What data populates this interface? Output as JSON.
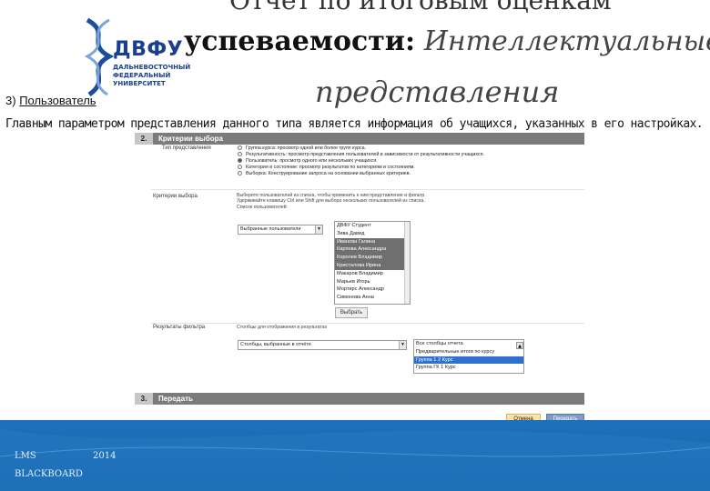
{
  "logo": {
    "name": "ДВФУ",
    "lines": [
      "ДАЛЬНЕВОСТОЧНЫЙ",
      "ФЕДЕРАЛЬНЫЙ",
      "УНИВЕРСИТЕТ"
    ]
  },
  "title": {
    "line1_partial": "Отчет по итоговым оценкам",
    "line2_bold": "успеваемости:",
    "line2_italic": "Интеллектуальные",
    "line3": "представления"
  },
  "section": {
    "number": "3)",
    "label": "Пользователь"
  },
  "description": "Главным параметром представления данного типа является информация об учащихся, указанных в его настройках.",
  "panel": {
    "step2": {
      "number": "2.",
      "title": "Критерии выбора"
    },
    "row_type": {
      "label": "Тип представления",
      "options": [
        {
          "text": "Группа курса: просмотр одной или более групп курса.",
          "selected": false
        },
        {
          "text": "Результативность: просмотр представления пользователей в зависимости от результативности учащихся.",
          "selected": false
        },
        {
          "text": "Пользователь: просмотр одного или нескольких учащихся.",
          "selected": true
        },
        {
          "text": "Категория и состояние: просмотр результатов по категориям и состояниям.",
          "selected": false
        },
        {
          "text": "Выборка: Конструирование запроса на основании выбранных критериев.",
          "selected": false
        }
      ]
    },
    "row_criteria": {
      "label": "Критерии выбора",
      "help_lines": [
        "Выберите пользователей из списка, чтобы применить к ним представление и фильтр.",
        "Удерживайте клавишу Ctrl или Shift для выбора нескольких пользователей из списка.",
        "Список пользователей:"
      ],
      "select_value": "Выбранные пользователи",
      "users": [
        {
          "name": "ДВФУ Студент",
          "state": "normal"
        },
        {
          "name": "Зива Давид",
          "state": "normal"
        },
        {
          "name": "Иванова Галина",
          "state": "selected"
        },
        {
          "name": "Карпова Александра",
          "state": "selected"
        },
        {
          "name": "Королев Владимир",
          "state": "selected"
        },
        {
          "name": "Кристалова Ирина",
          "state": "selected"
        },
        {
          "name": "Макаров Владимир",
          "state": "normal"
        },
        {
          "name": "Марьев Игорь",
          "state": "normal"
        },
        {
          "name": "Мортирс Александр",
          "state": "normal"
        },
        {
          "name": "Симонова Анна",
          "state": "normal"
        }
      ],
      "button": "Выбрать"
    },
    "row_filter": {
      "label": "Результаты фильтра",
      "help": "Столбцы для отображения в результатах",
      "select_value": "Столбцы, выбранные в отчёте",
      "columns": [
        {
          "name": "Все столбцы отчета",
          "state": "normal"
        },
        {
          "name": "Предварительные итоги по курсу",
          "state": "normal"
        },
        {
          "name": "Группа 1 2 Курс",
          "state": "blue"
        },
        {
          "name": "Группа ГК 1 Курс",
          "state": "normal"
        }
      ]
    },
    "step3": {
      "number": "3.",
      "title": "Передать"
    },
    "cancel": "Отмена",
    "submit": "Передать"
  },
  "footer": {
    "left_top": "LMS",
    "left_bottom": "BLACKBOARD",
    "year": "2014"
  },
  "colors": {
    "footer_blue": "#1a6cb3",
    "logo_blue": "#1a3f8f",
    "bar_gray": "#7b7b7b",
    "highlight_blue": "#2f6fcf"
  }
}
